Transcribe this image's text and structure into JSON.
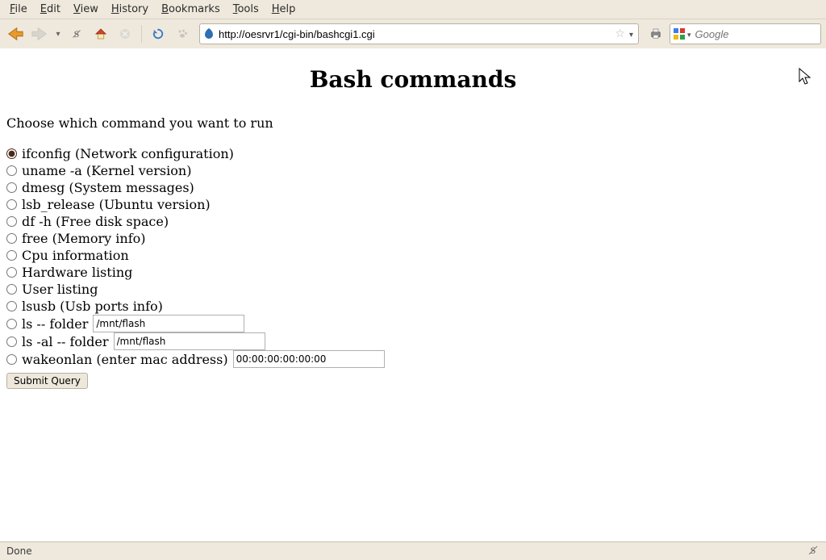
{
  "menu": {
    "file": "File",
    "edit": "Edit",
    "view": "View",
    "history": "History",
    "bookmarks": "Bookmarks",
    "tools": "Tools",
    "help": "Help"
  },
  "url": "http://oesrvr1/cgi-bin/bashcgi1.cgi",
  "search_placeholder": "Google",
  "page": {
    "title": "Bash commands",
    "prompt": "Choose which command you want to run",
    "options": [
      {
        "id": "ifconfig",
        "label": "ifconfig (Network configuration)",
        "checked": true
      },
      {
        "id": "uname",
        "label": "uname -a (Kernel version)",
        "checked": false
      },
      {
        "id": "dmesg",
        "label": "dmesg (System messages)",
        "checked": false
      },
      {
        "id": "lsb_release",
        "label": "lsb_release (Ubuntu version)",
        "checked": false
      },
      {
        "id": "df",
        "label": "df -h (Free disk space)",
        "checked": false
      },
      {
        "id": "free",
        "label": "free (Memory info)",
        "checked": false
      },
      {
        "id": "cpu",
        "label": "Cpu information",
        "checked": false
      },
      {
        "id": "hw",
        "label": "Hardware listing",
        "checked": false
      },
      {
        "id": "user",
        "label": "User listing",
        "checked": false
      },
      {
        "id": "lsusb",
        "label": "lsusb (Usb ports info)",
        "checked": false
      },
      {
        "id": "ls",
        "label": "ls -- folder",
        "checked": false,
        "input_value": "/mnt/flash",
        "input_width": 180
      },
      {
        "id": "lsal",
        "label": "ls -al -- folder",
        "checked": false,
        "input_value": "/mnt/flash",
        "input_width": 180
      },
      {
        "id": "wol",
        "label": "wakeonlan (enter mac address)",
        "checked": false,
        "input_value": "00:00:00:00:00:00",
        "input_width": 180
      }
    ],
    "submit_label": "Submit Query"
  },
  "status": "Done"
}
